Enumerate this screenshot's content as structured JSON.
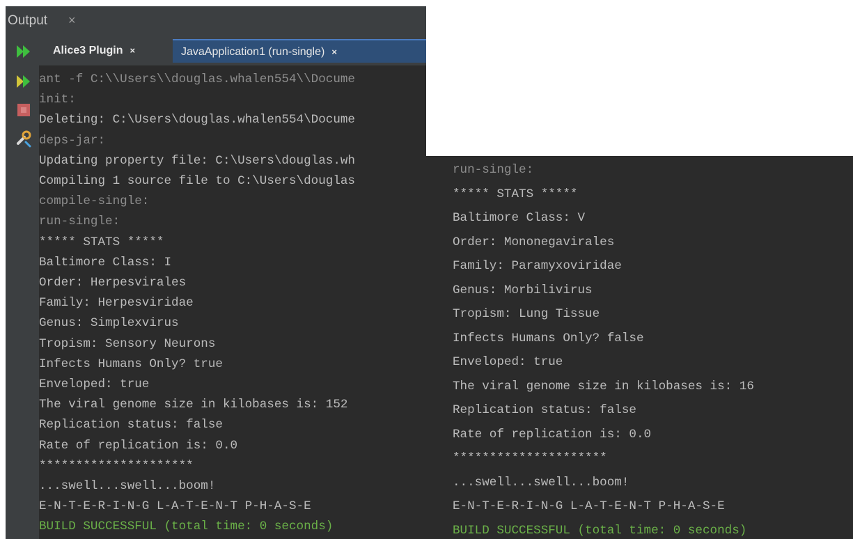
{
  "output_panel": {
    "title": "Output",
    "close_glyph": "×",
    "tabs": [
      {
        "label": "Alice3 Plugin",
        "close": "×"
      },
      {
        "label": "JavaApplication1 (run-single)",
        "close": "×"
      }
    ],
    "side_buttons": [
      "rerun-icon",
      "rerun-with-options-icon",
      "stop-icon",
      "settings-icon"
    ]
  },
  "left_console": {
    "lines": [
      {
        "text": "ant -f C:\\\\Users\\\\douglas.whalen554\\\\Docume",
        "style": "dim"
      },
      {
        "text": "init:",
        "style": "dim"
      },
      {
        "text": "Deleting: C:\\Users\\douglas.whalen554\\Docume",
        "style": "normal"
      },
      {
        "text": "deps-jar:",
        "style": "dim"
      },
      {
        "text": "Updating property file: C:\\Users\\douglas.wh",
        "style": "normal"
      },
      {
        "text": "Compiling 1 source file to C:\\Users\\douglas",
        "style": "normal"
      },
      {
        "text": "compile-single:",
        "style": "dim"
      },
      {
        "text": "run-single:",
        "style": "dim"
      },
      {
        "text": "***** STATS *****",
        "style": "normal"
      },
      {
        "text": "Baltimore Class: I",
        "style": "normal"
      },
      {
        "text": "Order: Herpesvirales",
        "style": "normal"
      },
      {
        "text": "Family: Herpesviridae",
        "style": "normal"
      },
      {
        "text": "Genus: Simplexvirus",
        "style": "normal"
      },
      {
        "text": "Tropism: Sensory Neurons",
        "style": "normal"
      },
      {
        "text": "Infects Humans Only? true",
        "style": "normal"
      },
      {
        "text": "Enveloped: true",
        "style": "normal"
      },
      {
        "text": "The viral genome size in kilobases is: 152",
        "style": "normal"
      },
      {
        "text": "Replication status: false",
        "style": "normal"
      },
      {
        "text": "Rate of replication is: 0.0",
        "style": "normal"
      },
      {
        "text": "*********************",
        "style": "normal"
      },
      {
        "text": "...swell...swell...boom!",
        "style": "normal"
      },
      {
        "text": "E-N-T-E-R-I-N-G L-A-T-E-N-T P-H-A-S-E",
        "style": "normal"
      },
      {
        "text": "BUILD SUCCESSFUL (total time: 0 seconds)",
        "style": "green"
      }
    ]
  },
  "right_console": {
    "lines": [
      {
        "text": "run-single:",
        "style": "dim"
      },
      {
        "text": "***** STATS *****",
        "style": "normal"
      },
      {
        "text": "Baltimore Class: V",
        "style": "normal"
      },
      {
        "text": "Order: Mononegavirales",
        "style": "normal"
      },
      {
        "text": "Family: Paramyxoviridae",
        "style": "normal"
      },
      {
        "text": "Genus: Morbilivirus",
        "style": "normal"
      },
      {
        "text": "Tropism: Lung Tissue",
        "style": "normal"
      },
      {
        "text": "Infects Humans Only? false",
        "style": "normal"
      },
      {
        "text": "Enveloped: true",
        "style": "normal"
      },
      {
        "text": "The viral genome size in kilobases is: 16",
        "style": "normal"
      },
      {
        "text": "Replication status: false",
        "style": "normal"
      },
      {
        "text": "Rate of replication is: 0.0",
        "style": "normal"
      },
      {
        "text": "*********************",
        "style": "normal"
      },
      {
        "text": "...swell...swell...boom!",
        "style": "normal"
      },
      {
        "text": "E-N-T-E-R-I-N-G L-A-T-E-N-T P-H-A-S-E",
        "style": "normal"
      },
      {
        "text": "BUILD SUCCESSFUL (total time: 0 seconds)",
        "style": "green"
      }
    ]
  },
  "colors": {
    "panel_bg": "#2b2b2b",
    "chrome_bg": "#3c3f41",
    "active_tab": "#2e4f78",
    "text": "#bbbbbb",
    "dim_text": "#8d8d8d",
    "success": "#6ab048"
  }
}
